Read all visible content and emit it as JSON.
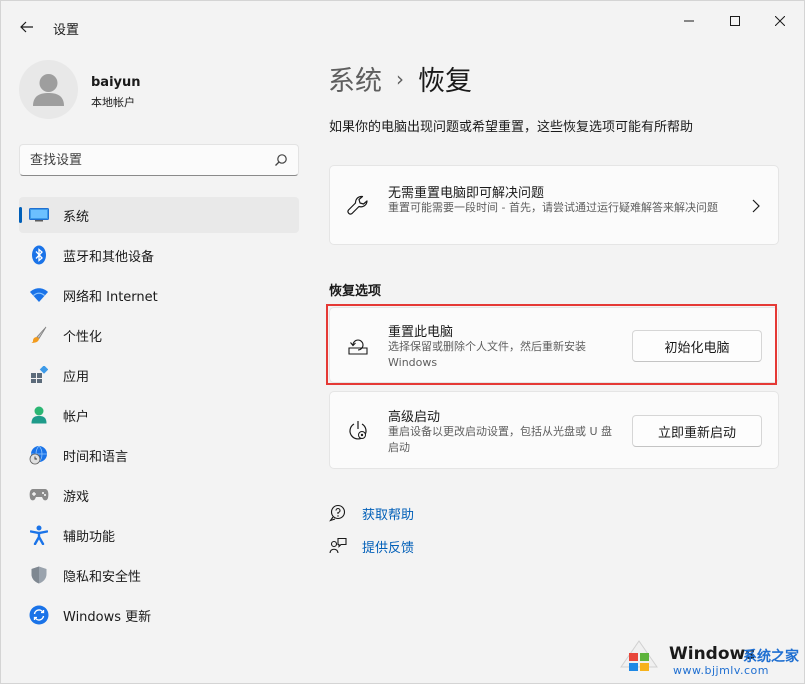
{
  "window": {
    "title": "设置"
  },
  "user": {
    "name": "baiyun",
    "account_type": "本地帐户"
  },
  "search": {
    "placeholder": "查找设置"
  },
  "sidebar": {
    "items": [
      {
        "label": "系统",
        "icon": "system-icon",
        "active": true
      },
      {
        "label": "蓝牙和其他设备",
        "icon": "bluetooth-icon"
      },
      {
        "label": "网络和 Internet",
        "icon": "wifi-icon"
      },
      {
        "label": "个性化",
        "icon": "brush-icon"
      },
      {
        "label": "应用",
        "icon": "apps-icon"
      },
      {
        "label": "帐户",
        "icon": "account-icon"
      },
      {
        "label": "时间和语言",
        "icon": "globe-clock-icon"
      },
      {
        "label": "游戏",
        "icon": "gamepad-icon"
      },
      {
        "label": "辅助功能",
        "icon": "accessibility-icon"
      },
      {
        "label": "隐私和安全性",
        "icon": "shield-icon"
      },
      {
        "label": "Windows 更新",
        "icon": "sync-icon"
      }
    ]
  },
  "breadcrumb": {
    "parent": "系统",
    "separator": "›",
    "current": "恢复"
  },
  "page": {
    "description": "如果你的电脑出现问题或希望重置，这些恢复选项可能有所帮助"
  },
  "fix_card": {
    "title": "无需重置电脑即可解决问题",
    "description": "重置可能需要一段时间 - 首先，请尝试通过运行疑难解答来解决问题",
    "icon": "wrench-icon"
  },
  "recovery": {
    "section_title": "恢复选项",
    "reset": {
      "title": "重置此电脑",
      "description": "选择保留或删除个人文件，然后重新安装 Windows",
      "button": "初始化电脑",
      "icon": "reset-pc-icon"
    },
    "advanced": {
      "title": "高级启动",
      "description": "重启设备以更改启动设置，包括从光盘或 U 盘启动",
      "button": "立即重新启动",
      "icon": "advanced-startup-icon"
    }
  },
  "links": {
    "help": "获取帮助",
    "feedback": "提供反馈"
  },
  "watermark": {
    "brand": "Windows",
    "site": "系统之家",
    "url": "www.bjjmlv.com"
  },
  "colors": {
    "accent": "#005fb8",
    "highlight_border": "#e53935",
    "background": "#f3f3f3",
    "card": "#fbfbfb"
  }
}
